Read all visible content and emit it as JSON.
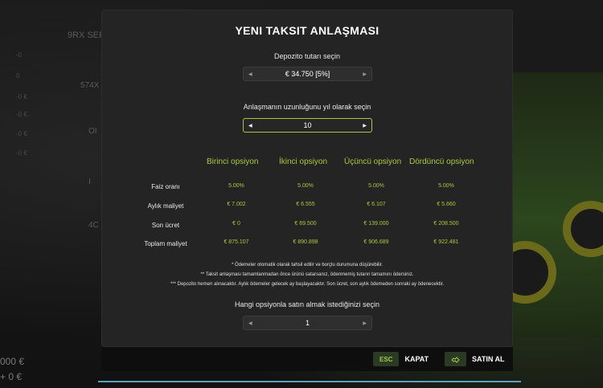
{
  "background": {
    "top_label": "9RX SER",
    "mid_label": "574X",
    "side_label_1": "OI",
    "side_label_2": "I",
    "side_label_3": "4C",
    "total_1": "000 €",
    "total_2": "+ 0 €",
    "ticks": [
      "-0",
      "0",
      "-0 €",
      "-0 €",
      "-0 €",
      "-0 €"
    ]
  },
  "modal": {
    "title": "YENI TAKSIT ANLAŞMASI",
    "deposit_label": "Depozito tutarı seçin",
    "deposit_value": "€ 34.750 [5%]",
    "duration_label": "Anlaşmanın uzunluğunu yıl olarak seçin",
    "duration_value": "10",
    "options": [
      "Birinci opsiyon",
      "İkinci opsiyon",
      "Üçüncü opsiyon",
      "Dördüncü opsiyon"
    ],
    "rows": [
      {
        "label": "Faiz oranı",
        "values": [
          "5.00%",
          "5.00%",
          "5.00%",
          "5.00%"
        ]
      },
      {
        "label": "Aylık maliyet",
        "values": [
          "€ 7.002",
          "€ 6.555",
          "€ 6.107",
          "€ 5.660"
        ]
      },
      {
        "label": "Son ücret",
        "values": [
          "€ 0",
          "€ 69.500",
          "€ 139.000",
          "€ 208.500"
        ]
      },
      {
        "label": "Toplam maliyet",
        "values": [
          "€ 875.107",
          "€ 890.898",
          "€ 906.689",
          "€ 922.481"
        ]
      }
    ],
    "notes": [
      "* Ödemeler otomatik olarak tahsil edilir ve borçlu durumuna düşürebilir.",
      "** Taksit anlaşması tamamlanmadan önce ürünü satarsanız, ödenmemiş tutarın tamamını ödersiniz.",
      "*** Depozito hemen alınacaktır. Aylık ödemeler gelecek ay başlayacaktır. Son ücret, son aylık ödemeden sonraki ay ödenecektir."
    ],
    "option_select_label": "Hangi opsiyonla satın almak istediğinizi seçin",
    "option_select_value": "1"
  },
  "actions": {
    "close_key": "ESC",
    "close_label": "KAPAT",
    "buy_label": "SATIN AL"
  },
  "colors": {
    "accent": "#a8c83c",
    "panel": "#242424",
    "progress_line": "#5a9ec0"
  },
  "icons": {
    "left_arrow": "triangle-left-icon",
    "right_arrow": "triangle-right-icon",
    "buy": "handshake-icon"
  }
}
